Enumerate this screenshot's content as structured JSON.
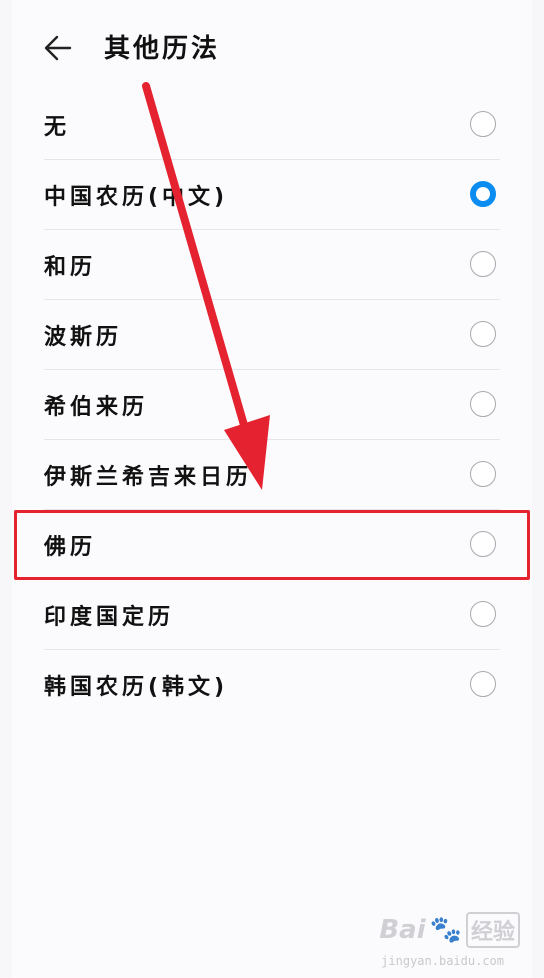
{
  "header": {
    "back_icon": "back-arrow-icon",
    "title": "其他历法"
  },
  "options": [
    {
      "label": "无",
      "selected": false
    },
    {
      "label": "中国农历(中文)",
      "selected": true
    },
    {
      "label": "和历",
      "selected": false
    },
    {
      "label": "波斯历",
      "selected": false
    },
    {
      "label": "希伯来历",
      "selected": false
    },
    {
      "label": "伊斯兰希吉来日历",
      "selected": false
    },
    {
      "label": "佛历",
      "selected": false
    },
    {
      "label": "印度国定历",
      "selected": false
    },
    {
      "label": "韩国农历(韩文)",
      "selected": false
    }
  ],
  "annotation": {
    "highlighted_option": "佛历",
    "color": "#e5222f"
  },
  "watermark": {
    "brand": "Bai",
    "paw": "🐾",
    "suffix": "经验",
    "url": "jingyan.baidu.com"
  },
  "colors": {
    "accent": "#0a8cf0",
    "annotation": "#e5222f"
  }
}
